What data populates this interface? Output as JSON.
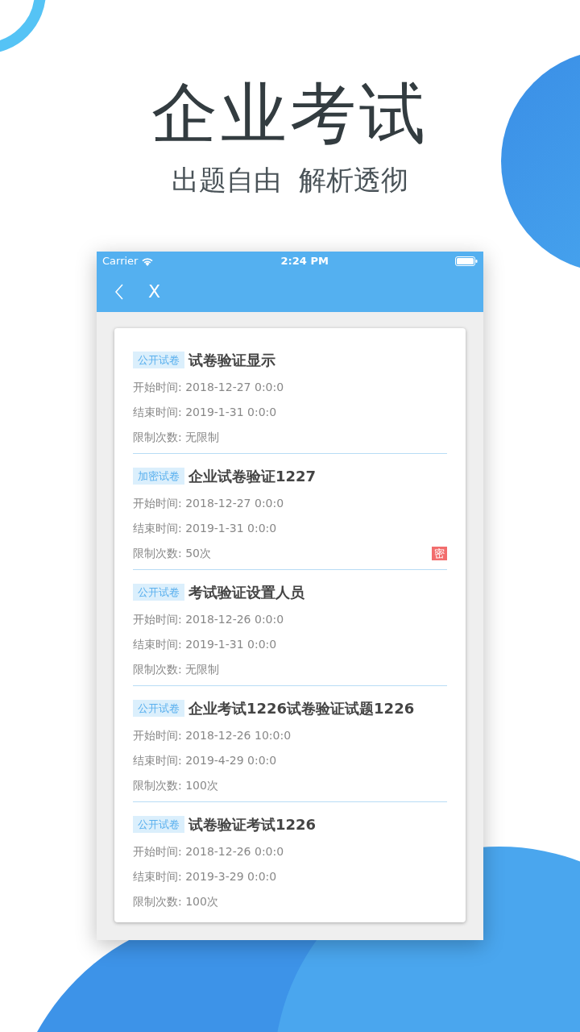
{
  "headline": "企业考试",
  "subheadline": "出题自由  解析透彻",
  "status_bar": {
    "carrier": "Carrier",
    "time": "2:24 PM"
  },
  "nav": {
    "close": "X"
  },
  "exams": [
    {
      "tag": "公开试卷",
      "title": "试卷验证显示",
      "start": "开始时间: 2018-12-27 0:0:0",
      "end": "结束时间: 2019-1-31 0:0:0",
      "limit": "限制次数: 无限制"
    },
    {
      "tag": "加密试卷",
      "title": "企业试卷验证1227",
      "start": "开始时间: 2018-12-27 0:0:0",
      "end": "结束时间: 2019-1-31 0:0:0",
      "limit": "限制次数: 50次",
      "badge": "密"
    },
    {
      "tag": "公开试卷",
      "title": "考试验证设置人员",
      "start": "开始时间: 2018-12-26 0:0:0",
      "end": "结束时间: 2019-1-31 0:0:0",
      "limit": "限制次数: 无限制"
    },
    {
      "tag": "公开试卷",
      "title": "企业考试1226试卷验证试题1226",
      "start": "开始时间: 2018-12-26 10:0:0",
      "end": "结束时间: 2019-4-29 0:0:0",
      "limit": "限制次数: 100次"
    },
    {
      "tag": "公开试卷",
      "title": "试卷验证考试1226",
      "start": "开始时间: 2018-12-26 0:0:0",
      "end": "结束时间: 2019-3-29 0:0:0",
      "limit": "限制次数: 100次"
    }
  ]
}
